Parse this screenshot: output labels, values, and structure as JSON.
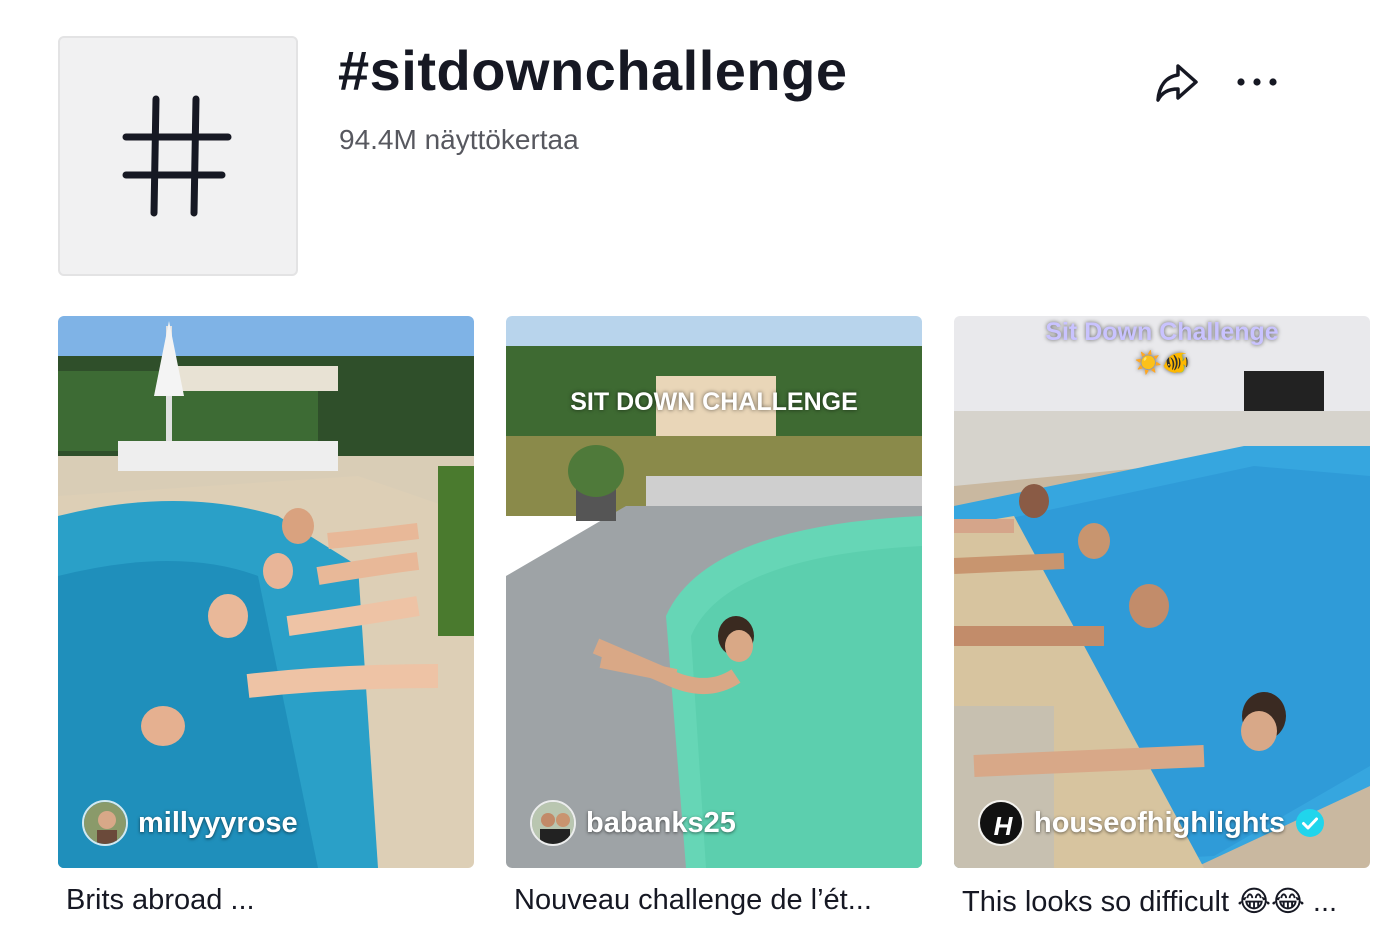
{
  "hashtag": {
    "title": "#sitdownchallenge",
    "views": "94.4M näyttökertaa"
  },
  "icons": {
    "tag": "hashtag-icon",
    "share": "share-icon",
    "more": "more-options-icon",
    "verified": "verified-badge-icon"
  },
  "videos": [
    {
      "author": "millyyyrose",
      "caption": "Brits abroad ...",
      "overlay": ""
    },
    {
      "author": "babanks25",
      "caption": "Nouveau challenge de l’ét...",
      "overlay": "SIT DOWN CHALLENGE"
    },
    {
      "author": "houseofhighlights",
      "caption": "This looks so difficult 😂😂 ...",
      "overlay": "Sit Down Challenge",
      "overlay_emoji": "☀️🐠",
      "verified": true
    }
  ]
}
